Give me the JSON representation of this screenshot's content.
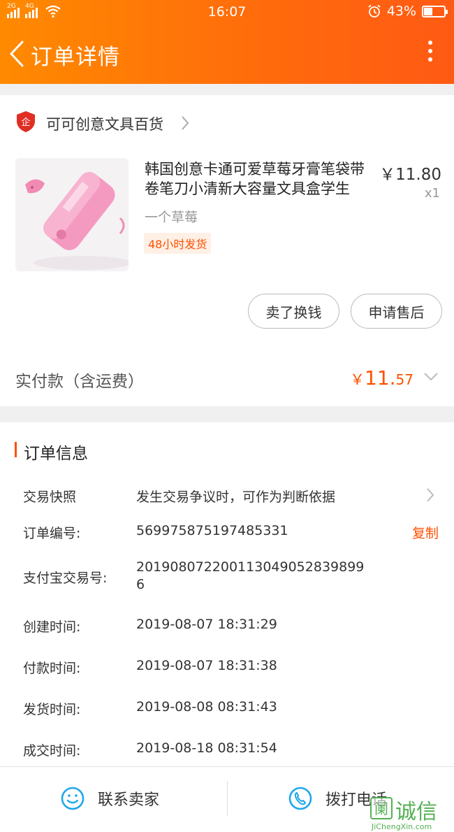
{
  "status_bar": {
    "signal1_tag": "2G",
    "signal2_tag": "4G",
    "time": "16:07",
    "battery_text": "43%",
    "battery_level": 0.43
  },
  "nav": {
    "title": "订单详情",
    "back_icon": "chevron-left-icon",
    "more_icon": "more-vertical-icon"
  },
  "shop": {
    "name": "可可创意文具百货",
    "logo_text": "企"
  },
  "goods": {
    "title": "韩国创意卡通可爱草莓牙膏笔袋带卷笔刀小清新大容量文具盒学生",
    "price": "￥11.80",
    "qty": "x1",
    "sku": "一个草莓",
    "ship_tag": "48小时发货"
  },
  "actions": {
    "sell_label": "卖了换钱",
    "after_sale_label": "申请售后"
  },
  "payment": {
    "label": "实付款（含运费）",
    "currency": "￥",
    "integer": "11.",
    "decimal": "57"
  },
  "order_info": {
    "title": "订单信息",
    "rows": [
      {
        "label": "交易快照",
        "value": "发生交易争议时，可作为判断依据"
      },
      {
        "label": "订单编号:",
        "value": "569975875197485331"
      },
      {
        "label": "支付宝交易号:",
        "value": "201908072200113049052839899",
        "value2": "6"
      },
      {
        "label": "创建时间:",
        "value": "2019-08-07 18:31:29"
      },
      {
        "label": "付款时间:",
        "value": "2019-08-07 18:31:38"
      },
      {
        "label": "发货时间:",
        "value": "2019-08-08 08:31:43"
      },
      {
        "label": "成交时间:",
        "value": "2019-08-18 08:31:54"
      }
    ],
    "copy_label": "复制"
  },
  "bottom_bar": {
    "contact_label": "联系卖家",
    "call_label": "拨打电话"
  },
  "watermark": {
    "icon_text": "阑",
    "text": "诚信",
    "url_text": "JiChengXin.com"
  },
  "colors": {
    "accent": "#ff5000",
    "header_start": "#ff8a00",
    "header_end": "#ff5a14",
    "icon_blue": "#1ea7ea"
  }
}
